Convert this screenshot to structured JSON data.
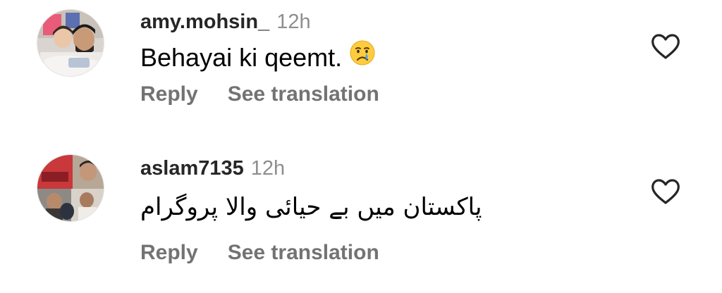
{
  "comments": [
    {
      "username": "amy.mohsin_",
      "timestamp": "12h",
      "text": "Behayai ki qeemt.",
      "emoji": "crying-face",
      "reply_label": "Reply",
      "translate_label": "See translation",
      "like_icon": "heart-outline-icon"
    },
    {
      "username": "aslam7135",
      "timestamp": "12h",
      "text": "پاکستان میں بے حیائی والا پروگرام",
      "reply_label": "Reply",
      "translate_label": "See translation",
      "like_icon": "heart-outline-icon"
    }
  ],
  "colors": {
    "username": "#262626",
    "timestamp": "#8e8e8e",
    "action_text": "#737373",
    "icon_stroke": "#262626"
  }
}
